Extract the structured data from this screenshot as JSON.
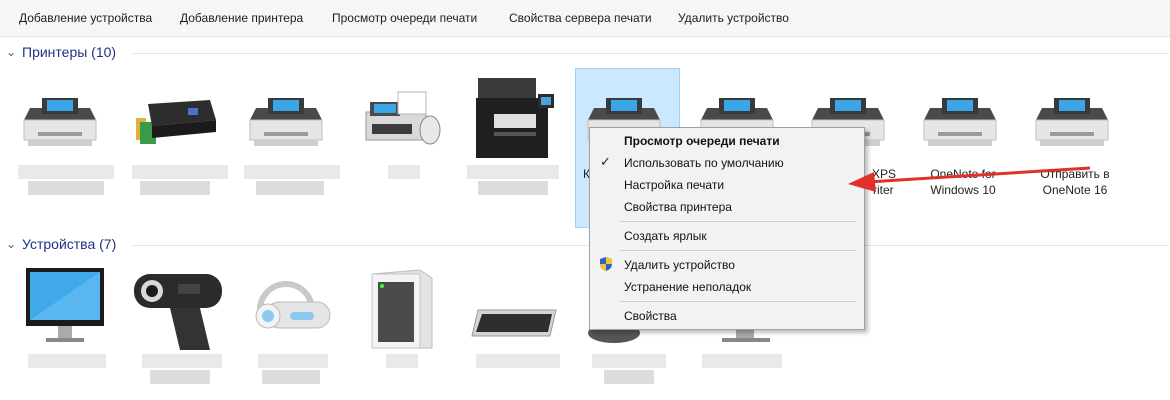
{
  "toolbar": {
    "add_device": "Добавление устройства",
    "add_printer": "Добавление принтера",
    "print_queue": "Просмотр очереди печати",
    "server_props": "Свойства сервера печати",
    "remove_device": "Удалить устройство"
  },
  "groups": {
    "printers": "Принтеры (10)",
    "devices": "Устройства (7)"
  },
  "printers": {
    "partial_label_k": "К",
    "xps_line1": "XPS",
    "xps_line2": "riter",
    "onenote10_line1": "OneNote for",
    "onenote10_line2": "Windows 10",
    "onenote16_line1": "Отправить в",
    "onenote16_line2": "OneNote 16"
  },
  "context_menu": {
    "view_queue": "Просмотр очереди печати",
    "set_default": "Использовать по умолчанию",
    "print_settings": "Настройка печати",
    "printer_props": "Свойства принтера",
    "create_shortcut": "Создать ярлык",
    "remove_device": "Удалить устройство",
    "troubleshoot": "Устранение неполадок",
    "properties": "Свойства"
  },
  "colors": {
    "accent_header": "#1e3287",
    "selection_bg": "#cce8ff",
    "arrow": "#e0302a"
  }
}
